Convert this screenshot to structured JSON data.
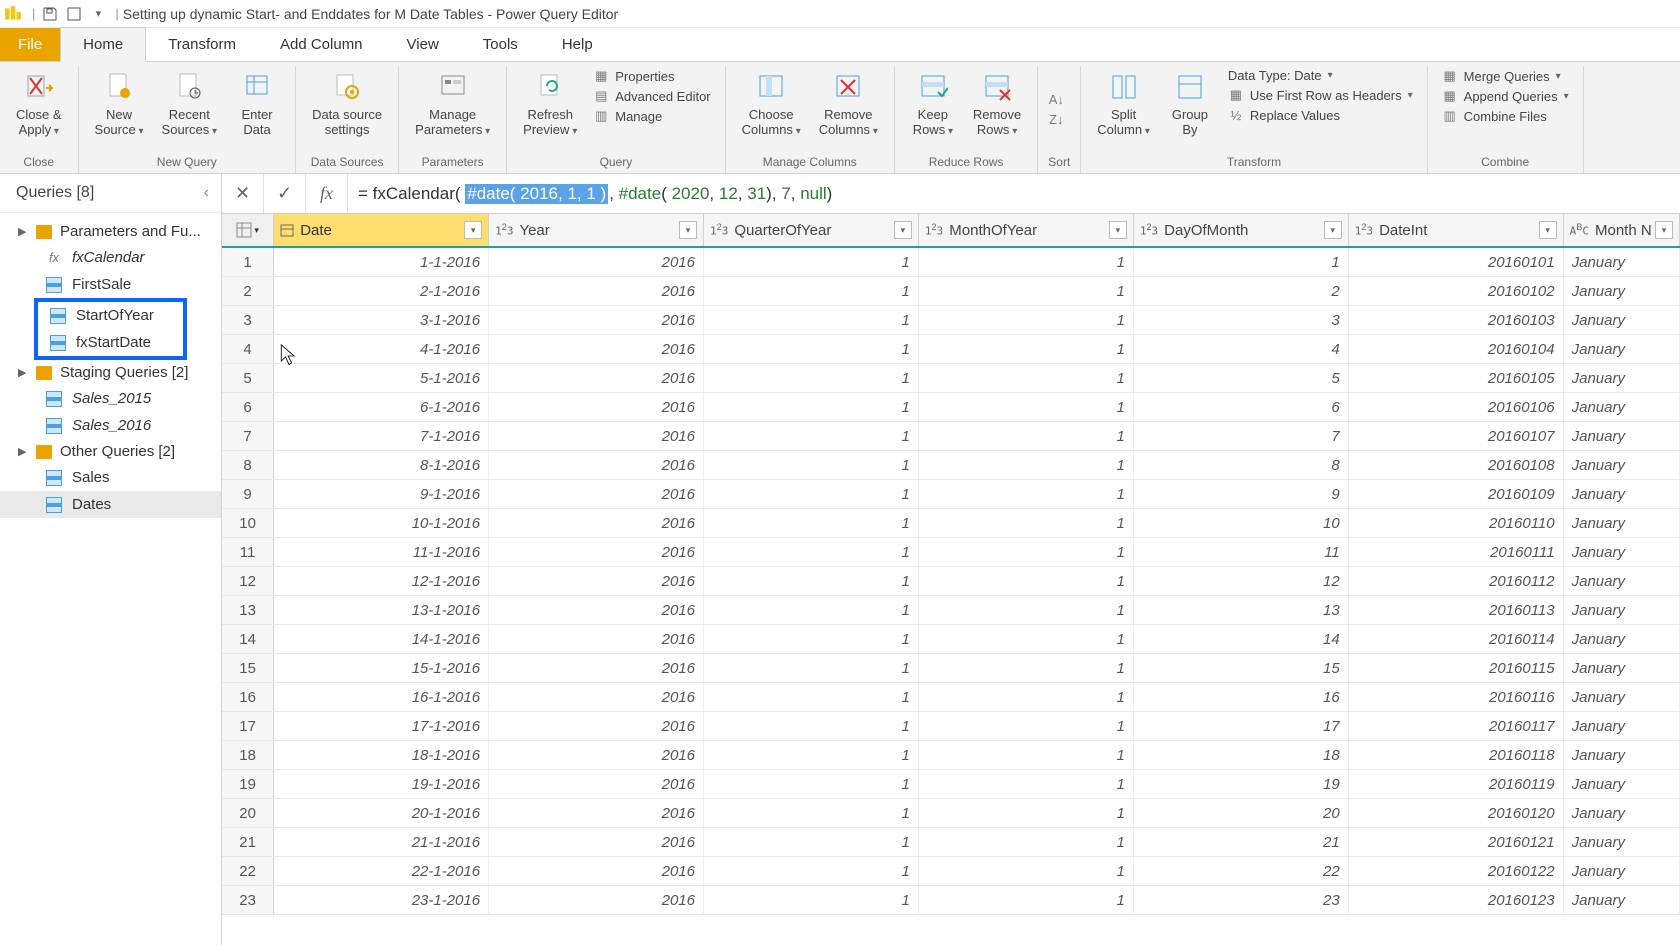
{
  "titlebar": {
    "title": "Setting up dynamic Start- and Enddates for M Date Tables - Power Query Editor"
  },
  "menu": {
    "file": "File",
    "home": "Home",
    "transform": "Transform",
    "addcolumn": "Add Column",
    "view": "View",
    "tools": "Tools",
    "help": "Help"
  },
  "ribbon": {
    "close_apply": "Close &\nApply",
    "close_grp": "Close",
    "new_source": "New\nSource",
    "recent_sources": "Recent\nSources",
    "enter_data": "Enter\nData",
    "newquery_grp": "New Query",
    "data_source_settings": "Data source\nsettings",
    "datasources_grp": "Data Sources",
    "manage_params": "Manage\nParameters",
    "parameters_grp": "Parameters",
    "refresh_preview": "Refresh\nPreview",
    "properties": "Properties",
    "advanced_editor": "Advanced Editor",
    "manage": "Manage",
    "query_grp": "Query",
    "choose_columns": "Choose\nColumns",
    "remove_columns": "Remove\nColumns",
    "managecols_grp": "Manage Columns",
    "keep_rows": "Keep\nRows",
    "remove_rows": "Remove\nRows",
    "reducerows_grp": "Reduce Rows",
    "sort_grp": "Sort",
    "split_column": "Split\nColumn",
    "group_by": "Group\nBy",
    "data_type": "Data Type: Date",
    "first_row_headers": "Use First Row as Headers",
    "replace_values": "Replace Values",
    "transform_grp": "Transform",
    "merge_queries": "Merge Queries",
    "append_queries": "Append Queries",
    "combine_files": "Combine Files",
    "combine_grp": "Combine"
  },
  "queries": {
    "title": "Queries [8]",
    "groups": [
      {
        "label": "Parameters and Fu...",
        "items": [
          {
            "label": "fxCalendar",
            "kind": "fx",
            "italic": true
          },
          {
            "label": "FirstSale",
            "kind": "tbl"
          },
          {
            "label": "StartOfYear",
            "kind": "tbl",
            "highlight": true
          },
          {
            "label": "fxStartDate",
            "kind": "tbl",
            "highlight": true
          }
        ]
      },
      {
        "label": "Staging Queries [2]",
        "items": [
          {
            "label": "Sales_2015",
            "kind": "tbl",
            "italic": true
          },
          {
            "label": "Sales_2016",
            "kind": "tbl",
            "italic": true
          }
        ]
      },
      {
        "label": "Other Queries [2]",
        "items": [
          {
            "label": "Sales",
            "kind": "tbl"
          },
          {
            "label": "Dates",
            "kind": "tbl",
            "selected": true
          }
        ]
      }
    ]
  },
  "formula": {
    "prefix": "= fxCalendar( ",
    "sel": "#date( 2016, 1, 1 )",
    "mid": ", ",
    "fn2": "#date",
    "open2": "( ",
    "y2": "2020",
    "c1": ", ",
    "m2": "12",
    "c2": ", ",
    "d2": "31",
    "close2": "), ",
    "arg3": "7",
    "c3": ", ",
    "arg4": "null",
    "end": ")"
  },
  "columns": [
    {
      "key": "Date",
      "label": "Date",
      "type": "cal",
      "w": "w-date",
      "selected": true
    },
    {
      "key": "Year",
      "label": "Year",
      "type": "123",
      "w": "w-year"
    },
    {
      "key": "QuarterOfYear",
      "label": "QuarterOfYear",
      "type": "123",
      "w": "w-qoy"
    },
    {
      "key": "MonthOfYear",
      "label": "MonthOfYear",
      "type": "123",
      "w": "w-moy"
    },
    {
      "key": "DayOfMonth",
      "label": "DayOfMonth",
      "type": "123",
      "w": "w-dom"
    },
    {
      "key": "DateInt",
      "label": "DateInt",
      "type": "123",
      "w": "w-dint"
    },
    {
      "key": "MonthName",
      "label": "Month N",
      "type": "abc",
      "w": "w-mname",
      "align": "left"
    }
  ],
  "rows": [
    {
      "n": 1,
      "Date": "1-1-2016",
      "Year": "2016",
      "QuarterOfYear": "1",
      "MonthOfYear": "1",
      "DayOfMonth": "1",
      "DateInt": "20160101",
      "MonthName": "January"
    },
    {
      "n": 2,
      "Date": "2-1-2016",
      "Year": "2016",
      "QuarterOfYear": "1",
      "MonthOfYear": "1",
      "DayOfMonth": "2",
      "DateInt": "20160102",
      "MonthName": "January"
    },
    {
      "n": 3,
      "Date": "3-1-2016",
      "Year": "2016",
      "QuarterOfYear": "1",
      "MonthOfYear": "1",
      "DayOfMonth": "3",
      "DateInt": "20160103",
      "MonthName": "January"
    },
    {
      "n": 4,
      "Date": "4-1-2016",
      "Year": "2016",
      "QuarterOfYear": "1",
      "MonthOfYear": "1",
      "DayOfMonth": "4",
      "DateInt": "20160104",
      "MonthName": "January"
    },
    {
      "n": 5,
      "Date": "5-1-2016",
      "Year": "2016",
      "QuarterOfYear": "1",
      "MonthOfYear": "1",
      "DayOfMonth": "5",
      "DateInt": "20160105",
      "MonthName": "January"
    },
    {
      "n": 6,
      "Date": "6-1-2016",
      "Year": "2016",
      "QuarterOfYear": "1",
      "MonthOfYear": "1",
      "DayOfMonth": "6",
      "DateInt": "20160106",
      "MonthName": "January"
    },
    {
      "n": 7,
      "Date": "7-1-2016",
      "Year": "2016",
      "QuarterOfYear": "1",
      "MonthOfYear": "1",
      "DayOfMonth": "7",
      "DateInt": "20160107",
      "MonthName": "January"
    },
    {
      "n": 8,
      "Date": "8-1-2016",
      "Year": "2016",
      "QuarterOfYear": "1",
      "MonthOfYear": "1",
      "DayOfMonth": "8",
      "DateInt": "20160108",
      "MonthName": "January"
    },
    {
      "n": 9,
      "Date": "9-1-2016",
      "Year": "2016",
      "QuarterOfYear": "1",
      "MonthOfYear": "1",
      "DayOfMonth": "9",
      "DateInt": "20160109",
      "MonthName": "January"
    },
    {
      "n": 10,
      "Date": "10-1-2016",
      "Year": "2016",
      "QuarterOfYear": "1",
      "MonthOfYear": "1",
      "DayOfMonth": "10",
      "DateInt": "20160110",
      "MonthName": "January"
    },
    {
      "n": 11,
      "Date": "11-1-2016",
      "Year": "2016",
      "QuarterOfYear": "1",
      "MonthOfYear": "1",
      "DayOfMonth": "11",
      "DateInt": "20160111",
      "MonthName": "January"
    },
    {
      "n": 12,
      "Date": "12-1-2016",
      "Year": "2016",
      "QuarterOfYear": "1",
      "MonthOfYear": "1",
      "DayOfMonth": "12",
      "DateInt": "20160112",
      "MonthName": "January"
    },
    {
      "n": 13,
      "Date": "13-1-2016",
      "Year": "2016",
      "QuarterOfYear": "1",
      "MonthOfYear": "1",
      "DayOfMonth": "13",
      "DateInt": "20160113",
      "MonthName": "January"
    },
    {
      "n": 14,
      "Date": "14-1-2016",
      "Year": "2016",
      "QuarterOfYear": "1",
      "MonthOfYear": "1",
      "DayOfMonth": "14",
      "DateInt": "20160114",
      "MonthName": "January"
    },
    {
      "n": 15,
      "Date": "15-1-2016",
      "Year": "2016",
      "QuarterOfYear": "1",
      "MonthOfYear": "1",
      "DayOfMonth": "15",
      "DateInt": "20160115",
      "MonthName": "January"
    },
    {
      "n": 16,
      "Date": "16-1-2016",
      "Year": "2016",
      "QuarterOfYear": "1",
      "MonthOfYear": "1",
      "DayOfMonth": "16",
      "DateInt": "20160116",
      "MonthName": "January"
    },
    {
      "n": 17,
      "Date": "17-1-2016",
      "Year": "2016",
      "QuarterOfYear": "1",
      "MonthOfYear": "1",
      "DayOfMonth": "17",
      "DateInt": "20160117",
      "MonthName": "January"
    },
    {
      "n": 18,
      "Date": "18-1-2016",
      "Year": "2016",
      "QuarterOfYear": "1",
      "MonthOfYear": "1",
      "DayOfMonth": "18",
      "DateInt": "20160118",
      "MonthName": "January"
    },
    {
      "n": 19,
      "Date": "19-1-2016",
      "Year": "2016",
      "QuarterOfYear": "1",
      "MonthOfYear": "1",
      "DayOfMonth": "19",
      "DateInt": "20160119",
      "MonthName": "January"
    },
    {
      "n": 20,
      "Date": "20-1-2016",
      "Year": "2016",
      "QuarterOfYear": "1",
      "MonthOfYear": "1",
      "DayOfMonth": "20",
      "DateInt": "20160120",
      "MonthName": "January"
    },
    {
      "n": 21,
      "Date": "21-1-2016",
      "Year": "2016",
      "QuarterOfYear": "1",
      "MonthOfYear": "1",
      "DayOfMonth": "21",
      "DateInt": "20160121",
      "MonthName": "January"
    },
    {
      "n": 22,
      "Date": "22-1-2016",
      "Year": "2016",
      "QuarterOfYear": "1",
      "MonthOfYear": "1",
      "DayOfMonth": "22",
      "DateInt": "20160122",
      "MonthName": "January"
    },
    {
      "n": 23,
      "Date": "23-1-2016",
      "Year": "2016",
      "QuarterOfYear": "1",
      "MonthOfYear": "1",
      "DayOfMonth": "23",
      "DateInt": "20160123",
      "MonthName": "January"
    }
  ]
}
